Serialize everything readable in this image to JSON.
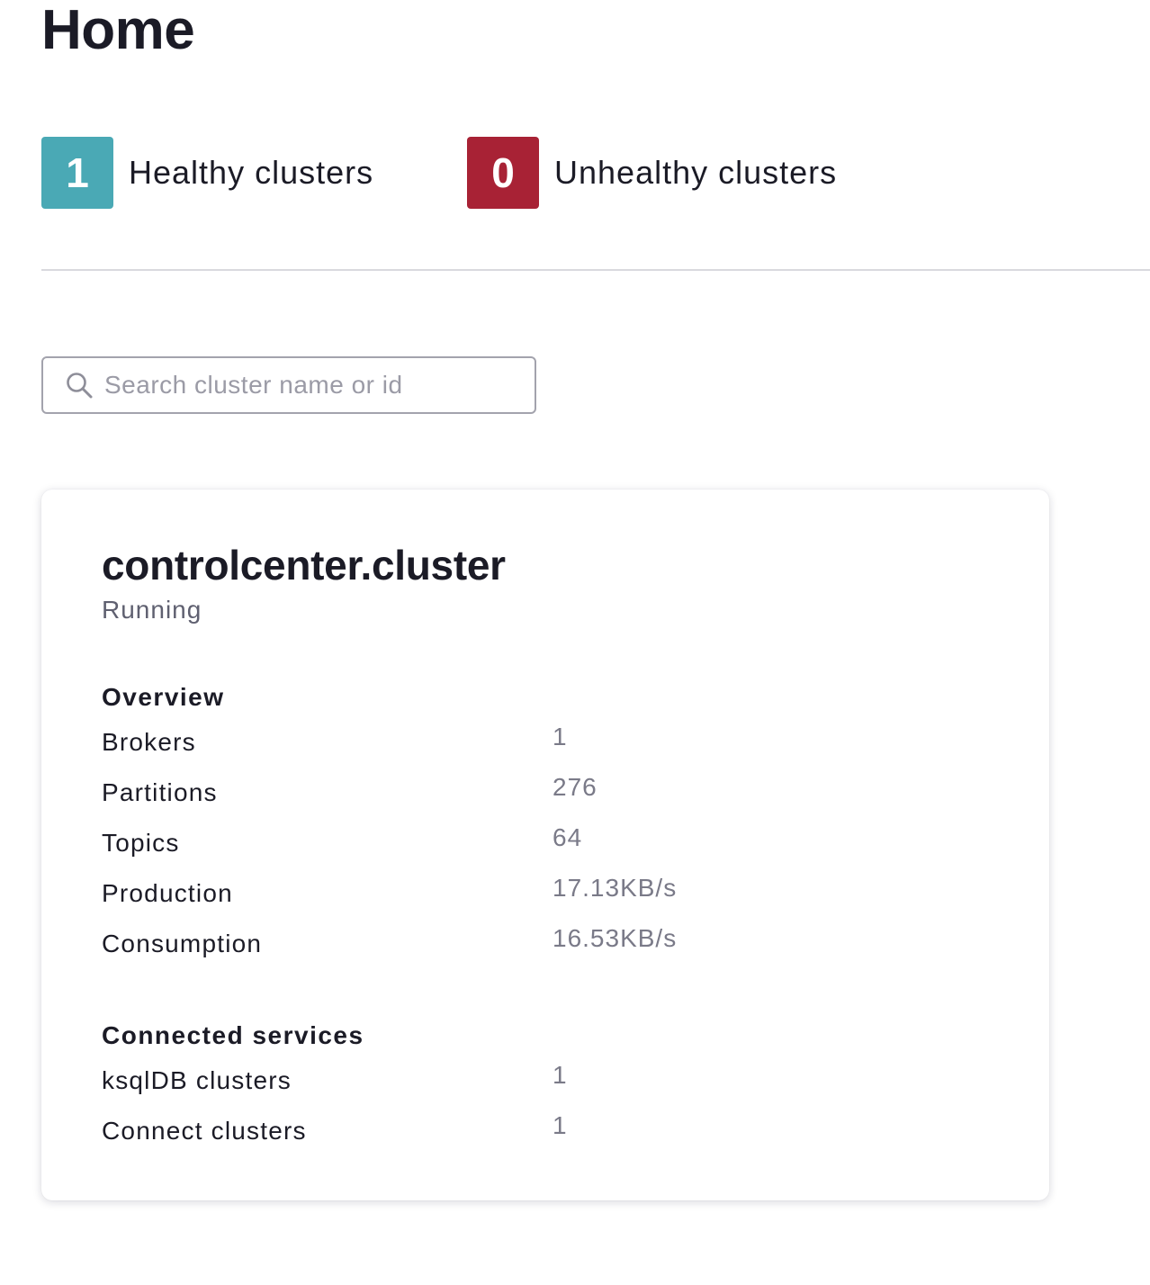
{
  "header": {
    "title": "Home"
  },
  "summary": {
    "healthy": {
      "count": "1",
      "label": "Healthy clusters",
      "color": "#4aa9b5"
    },
    "unhealthy": {
      "count": "0",
      "label": "Unhealthy clusters",
      "color": "#a82235"
    }
  },
  "search": {
    "placeholder": "Search cluster name or id",
    "value": "",
    "icon": "search-icon"
  },
  "cluster": {
    "name": "controlcenter.cluster",
    "status": "Running",
    "overview": {
      "title": "Overview",
      "rows": [
        {
          "label": "Brokers",
          "value": "1"
        },
        {
          "label": "Partitions",
          "value": "276"
        },
        {
          "label": "Topics",
          "value": "64"
        },
        {
          "label": "Production",
          "value": "17.13KB/s"
        },
        {
          "label": "Consumption",
          "value": "16.53KB/s"
        }
      ]
    },
    "connected_services": {
      "title": "Connected services",
      "rows": [
        {
          "label": "ksqlDB clusters",
          "value": "1"
        },
        {
          "label": "Connect clusters",
          "value": "1"
        }
      ]
    }
  }
}
